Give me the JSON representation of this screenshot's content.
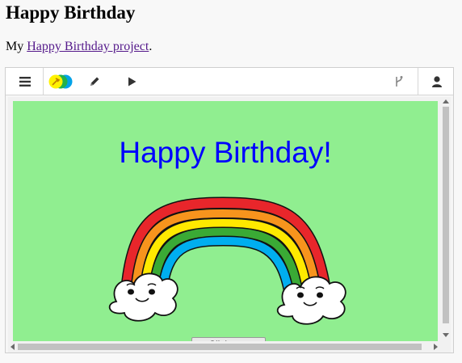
{
  "page": {
    "heading": "Happy Birthday",
    "intro_prefix": "My ",
    "intro_link": "Happy Birthday project",
    "intro_suffix": "."
  },
  "toolbar": {
    "icons": [
      "menu-icon",
      "app-logo-icon",
      "pencil-icon",
      "play-icon",
      "branch-icon",
      "user-icon"
    ]
  },
  "stage": {
    "title": "Happy Birthday!",
    "button_label": "Click to..."
  },
  "colors": {
    "stage_background": "#90ee90",
    "title_color": "#0000ff",
    "link_color": "#551a8b",
    "rainbow": [
      "#e8262b",
      "#f7941d",
      "#ffe900",
      "#3aaa35",
      "#00aeef"
    ]
  }
}
